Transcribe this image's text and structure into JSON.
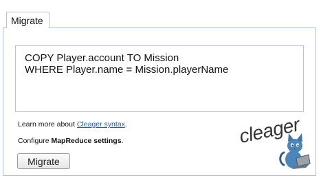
{
  "tab": {
    "label": "Migrate"
  },
  "editor": {
    "lines": [
      "COPY Player.account TO Mission",
      "WHERE Player.name = Mission.playerName"
    ]
  },
  "info": {
    "learn_prefix": "Learn more about ",
    "learn_link": "Cleager syntax",
    "learn_suffix": ".",
    "configure_prefix": "Configure ",
    "configure_bold": "MapReduce settings",
    "configure_suffix": "."
  },
  "button": {
    "label": "Migrate"
  },
  "logo": {
    "text": "cleager",
    "icon": "cat-with-laptop-icon"
  },
  "colors": {
    "border": "#a9c3dd",
    "link": "#1a5fb4"
  }
}
